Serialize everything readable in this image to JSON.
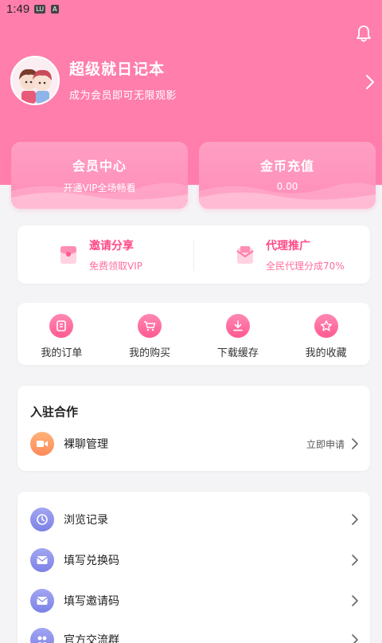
{
  "status_bar": {
    "time": "1:49",
    "badge1": "LU",
    "badge2": "A"
  },
  "profile": {
    "nickname": "超级就日记本",
    "vip_tip": "成为会员即可无限观影"
  },
  "vip_cards": [
    {
      "title": "会员中心",
      "subtitle": "开通VIP全场畅看"
    },
    {
      "title": "金币充值",
      "subtitle": "0.00"
    }
  ],
  "invite": [
    {
      "title": "邀请分享",
      "subtitle": "免费领取VIP",
      "icon": "red-envelope-icon"
    },
    {
      "title": "代理推广",
      "subtitle": "全民代理分成70%",
      "icon": "envelope-icon"
    }
  ],
  "quick_actions": [
    {
      "label": "我的订单",
      "icon": "order-icon"
    },
    {
      "label": "我的购买",
      "icon": "cart-icon"
    },
    {
      "label": "下载缓存",
      "icon": "download-icon"
    },
    {
      "label": "我的收藏",
      "icon": "star-icon"
    }
  ],
  "cooperation": {
    "title": "入驻合作",
    "item": {
      "label": "裸聊管理",
      "action": "立即申请",
      "icon": "video-camera-icon"
    }
  },
  "menu": [
    {
      "label": "浏览记录",
      "icon": "clock-icon"
    },
    {
      "label": "填写兑换码",
      "icon": "mail-icon"
    },
    {
      "label": "填写邀请码",
      "icon": "mail-icon"
    },
    {
      "label": "官方交流群",
      "icon": "group-icon"
    }
  ],
  "colors": {
    "brand_pink": "#ff7eab",
    "accent_text": "#ff4a86",
    "menu_icon": "#8a8fe8",
    "coop_icon": "#ff9a66"
  }
}
